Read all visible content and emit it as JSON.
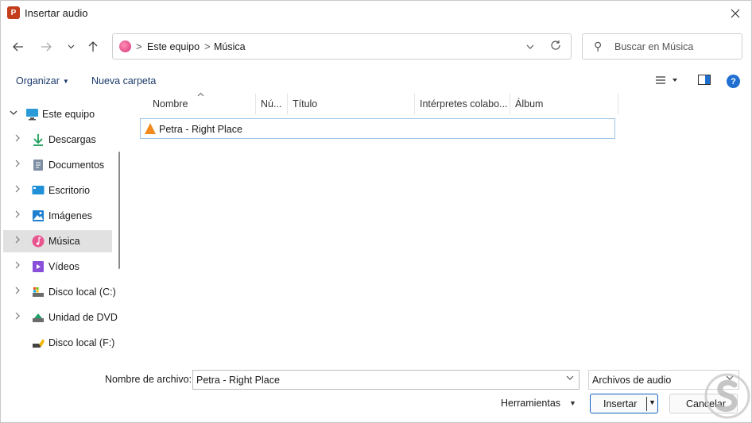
{
  "window": {
    "title": "Insertar audio",
    "app_icon_letter": "P"
  },
  "nav": {
    "back": "←",
    "forward": "→",
    "recent": "⌄",
    "up": "↑"
  },
  "address": {
    "separator": ">",
    "crumbs": [
      "Este equipo",
      "Música"
    ],
    "dropdown": "⌄",
    "refresh": "⟳"
  },
  "search": {
    "placeholder": "Buscar en Música",
    "icon": "⚲"
  },
  "commands": {
    "organize": "Organizar",
    "new_folder": "Nueva carpeta"
  },
  "sidebar": {
    "items": [
      {
        "label": "Este equipo",
        "icon": "computer-icon",
        "expanded": true
      },
      {
        "label": "Descargas",
        "icon": "download-icon"
      },
      {
        "label": "Documentos",
        "icon": "document-icon"
      },
      {
        "label": "Escritorio",
        "icon": "desktop-icon"
      },
      {
        "label": "Imágenes",
        "icon": "image-icon"
      },
      {
        "label": "Música",
        "icon": "music-icon",
        "selected": true
      },
      {
        "label": "Vídeos",
        "icon": "video-icon"
      },
      {
        "label": "Disco local (C:)",
        "icon": "drive-icon"
      },
      {
        "label": "Unidad de DVD",
        "icon": "dvd-icon"
      },
      {
        "label": "Disco local (F:)",
        "icon": "usb-drive-icon"
      }
    ]
  },
  "columns": [
    "Nombre",
    "Nú...",
    "Título",
    "Intérpretes colabo...",
    "Álbum"
  ],
  "files": [
    {
      "name": "Petra - Right Place",
      "icon": "vlc-icon"
    }
  ],
  "footer": {
    "filename_label": "Nombre de archivo:",
    "filename_value": "Petra - Right Place",
    "filetype_value": "Archivos de audio",
    "tools_label": "Herramientas",
    "insert_label": "Insertar",
    "cancel_label": "Cancelar"
  },
  "colors": {
    "accent": "#0f5fbf",
    "selection_border": "#9fc5e8",
    "selected_bg": "#e1e1e1"
  }
}
